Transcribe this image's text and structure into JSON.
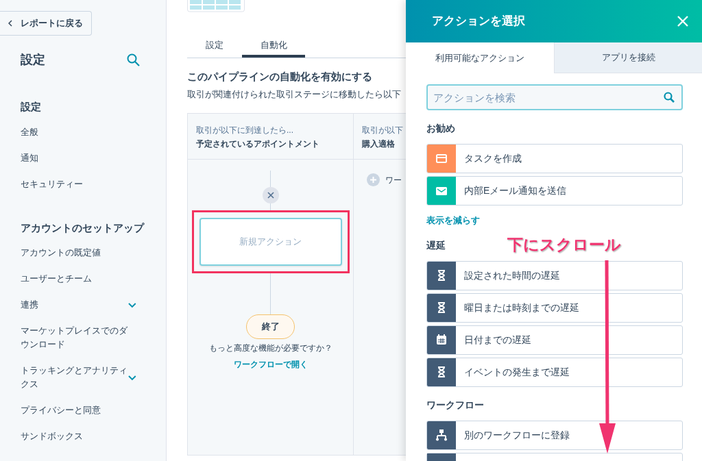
{
  "sidebar": {
    "back_button": "レポートに戻る",
    "title": "設定",
    "sections": [
      {
        "heading": "設定",
        "items": [
          {
            "label": "全般",
            "kind": "link"
          },
          {
            "label": "通知",
            "kind": "link"
          },
          {
            "label": "セキュリティー",
            "kind": "link"
          }
        ]
      },
      {
        "heading": "アカウントのセットアップ",
        "items": [
          {
            "label": "アカウントの既定値",
            "kind": "link"
          },
          {
            "label": "ユーザーとチーム",
            "kind": "link"
          },
          {
            "label": "連携",
            "kind": "group"
          },
          {
            "label": "マーケットプレイスでのダウンロード",
            "kind": "link"
          },
          {
            "label": "トラッキングとアナリティクス",
            "kind": "group"
          },
          {
            "label": "プライバシーと同意",
            "kind": "link"
          },
          {
            "label": "サンドボックス",
            "kind": "link"
          }
        ]
      }
    ]
  },
  "main": {
    "tabs": [
      {
        "label": "設定",
        "selected": false
      },
      {
        "label": "自動化",
        "selected": true
      }
    ],
    "heading": "このパイプラインの自動化を有効にする",
    "description": "取引が関連付けられた取引ステージに移動したら以下",
    "columns": [
      {
        "caption": "取引が以下に到達したら...",
        "stage": "予定されているアポイントメント",
        "new_action": "新規アクション",
        "end": "終了",
        "hint": "もっと高度な機能が必要ですか？",
        "link": "ワークフローで開く"
      },
      {
        "caption": "取引が以下",
        "stage": "購入適格",
        "add_label": "ワー"
      }
    ]
  },
  "panel": {
    "title": "アクションを選択",
    "tabs": [
      {
        "label": "利用可能なアクション",
        "selected": true
      },
      {
        "label": "アプリを接続",
        "selected": false
      }
    ],
    "search": {
      "placeholder": "アクションを検索"
    },
    "groups": [
      {
        "heading": "お勧め",
        "items": [
          {
            "label": "タスクを作成",
            "kind": "task",
            "color": "#ff8f59"
          },
          {
            "label": "内部Eメール通知を送信",
            "kind": "email",
            "color": "#00bda5"
          }
        ],
        "footer_link": "表示を減らす"
      },
      {
        "heading": "遅延",
        "items": [
          {
            "label": "設定された時間の遅延",
            "kind": "hourglass",
            "color": "#425b76"
          },
          {
            "label": "曜日または時刻までの遅延",
            "kind": "hourglass",
            "color": "#425b76"
          },
          {
            "label": "日付までの遅延",
            "kind": "calendar",
            "color": "#425b76"
          },
          {
            "label": "イベントの発生まで遅延",
            "kind": "hourglass",
            "color": "#425b76"
          }
        ]
      },
      {
        "heading": "ワークフロー",
        "items": [
          {
            "label": "別のワークフローに登録",
            "kind": "workflow",
            "color": "#425b76"
          }
        ]
      }
    ]
  },
  "annotation": {
    "text": "下にスクロール"
  }
}
